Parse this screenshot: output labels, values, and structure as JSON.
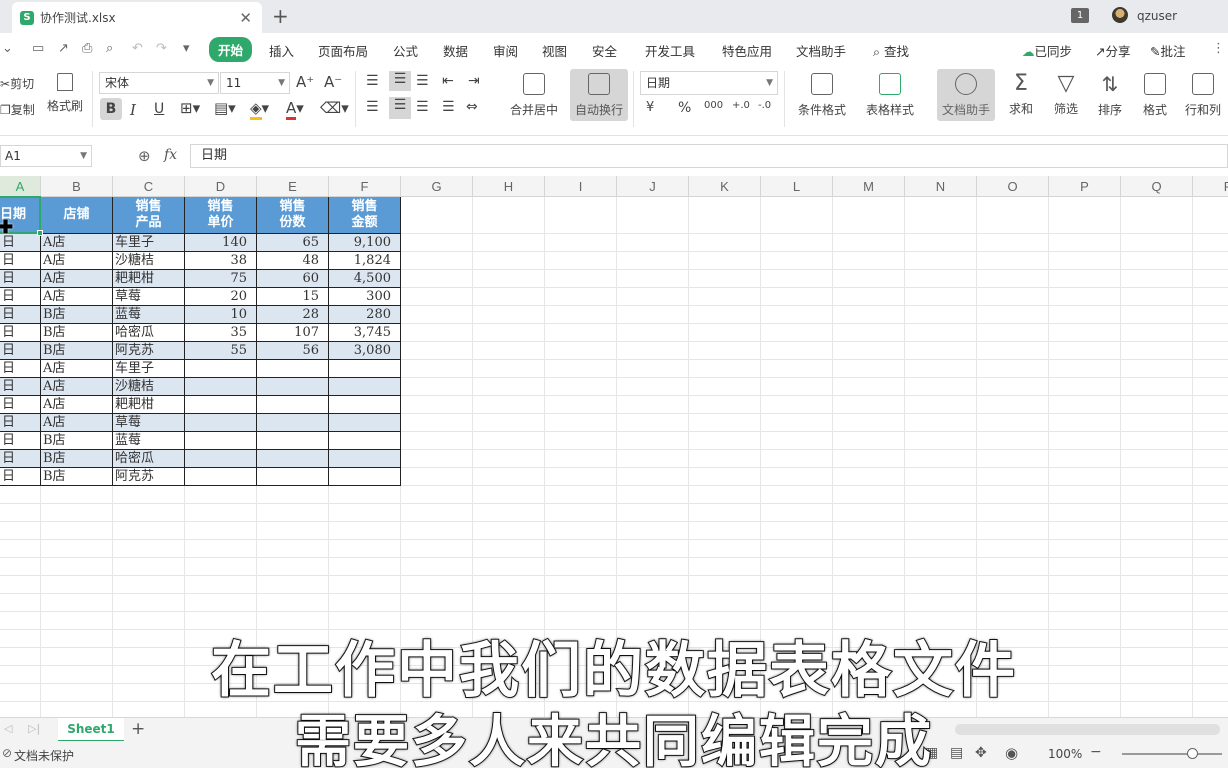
{
  "title_bar": {
    "app_icon": "S",
    "tab_title": "协作测试.xlsx",
    "close_glyph": "✕",
    "new_tab_glyph": "+",
    "window_count": "1",
    "user_name": "qzuser"
  },
  "menu": {
    "items": [
      "开始",
      "插入",
      "页面布局",
      "公式",
      "数据",
      "审阅",
      "视图",
      "安全",
      "开发工具",
      "特色应用",
      "文档助手",
      "查找"
    ],
    "active_index": 0,
    "right": [
      "已同步",
      "分享",
      "批注"
    ]
  },
  "ribbon": {
    "cut": "剪切",
    "copy": "复制",
    "format_painter": "格式刷",
    "font_name": "宋体",
    "font_size": "11",
    "bold": "B",
    "italic": "I",
    "grow_font": "A⁺",
    "shrink_font": "A⁻",
    "font_color_glyph": "A",
    "merge_center": "合并居中",
    "wrap_text": "自动换行",
    "number_format": "日期",
    "currency_glyph": "¥",
    "percent_glyph": "%",
    "thousands_glyph": "000",
    "inc_decimal_glyph": "+.0",
    "dec_decimal_glyph": "-.0",
    "conditional_format": "条件格式",
    "table_style": "表格样式",
    "doc_assistant": "文档助手",
    "sum": "求和",
    "filter": "筛选",
    "sort": "排序",
    "format": "格式",
    "rows_cols": "行和列"
  },
  "formula_bar": {
    "name_box": "A1",
    "fx": "fx",
    "content": "日期"
  },
  "columns": [
    "A",
    "B",
    "C",
    "D",
    "E",
    "F",
    "G",
    "H",
    "I",
    "J",
    "K",
    "L",
    "M",
    "N",
    "O",
    "P",
    "Q",
    "R"
  ],
  "header_row": [
    "日期",
    "店铺",
    "销售\n产品",
    "销售\n单价",
    "销售\n份数",
    "销售\n金额"
  ],
  "rows": [
    [
      "日",
      "A店",
      "车里子",
      "140",
      "65",
      "9,100"
    ],
    [
      "日",
      "A店",
      "沙糖桔",
      "38",
      "48",
      "1,824"
    ],
    [
      "日",
      "A店",
      "耙耙柑",
      "75",
      "60",
      "4,500"
    ],
    [
      "日",
      "A店",
      "草莓",
      "20",
      "15",
      "300"
    ],
    [
      "日",
      "B店",
      "蓝莓",
      "10",
      "28",
      "280"
    ],
    [
      "日",
      "B店",
      "哈密瓜",
      "35",
      "107",
      "3,745"
    ],
    [
      "日",
      "B店",
      "阿克苏",
      "55",
      "56",
      "3,080"
    ],
    [
      "日",
      "A店",
      "车里子",
      "",
      "",
      ""
    ],
    [
      "日",
      "A店",
      "沙糖桔",
      "",
      "",
      ""
    ],
    [
      "日",
      "A店",
      "耙耙柑",
      "",
      "",
      ""
    ],
    [
      "日",
      "A店",
      "草莓",
      "",
      "",
      ""
    ],
    [
      "日",
      "B店",
      "蓝莓",
      "",
      "",
      ""
    ],
    [
      "日",
      "B店",
      "哈密瓜",
      "",
      "",
      ""
    ],
    [
      "日",
      "B店",
      "阿克苏",
      "",
      "",
      ""
    ]
  ],
  "sheet_tabs": [
    "Sheet1"
  ],
  "add_sheet_glyph": "+",
  "status": {
    "protection": "文档未保护",
    "zoom": "100%"
  },
  "subtitles": [
    "在工作中我们的数据表格文件",
    "需要多人来共同编辑完成"
  ],
  "colors": {
    "accent": "#2fa86b",
    "header_fill": "#5b9bd5",
    "band_fill": "#dce6f1"
  }
}
